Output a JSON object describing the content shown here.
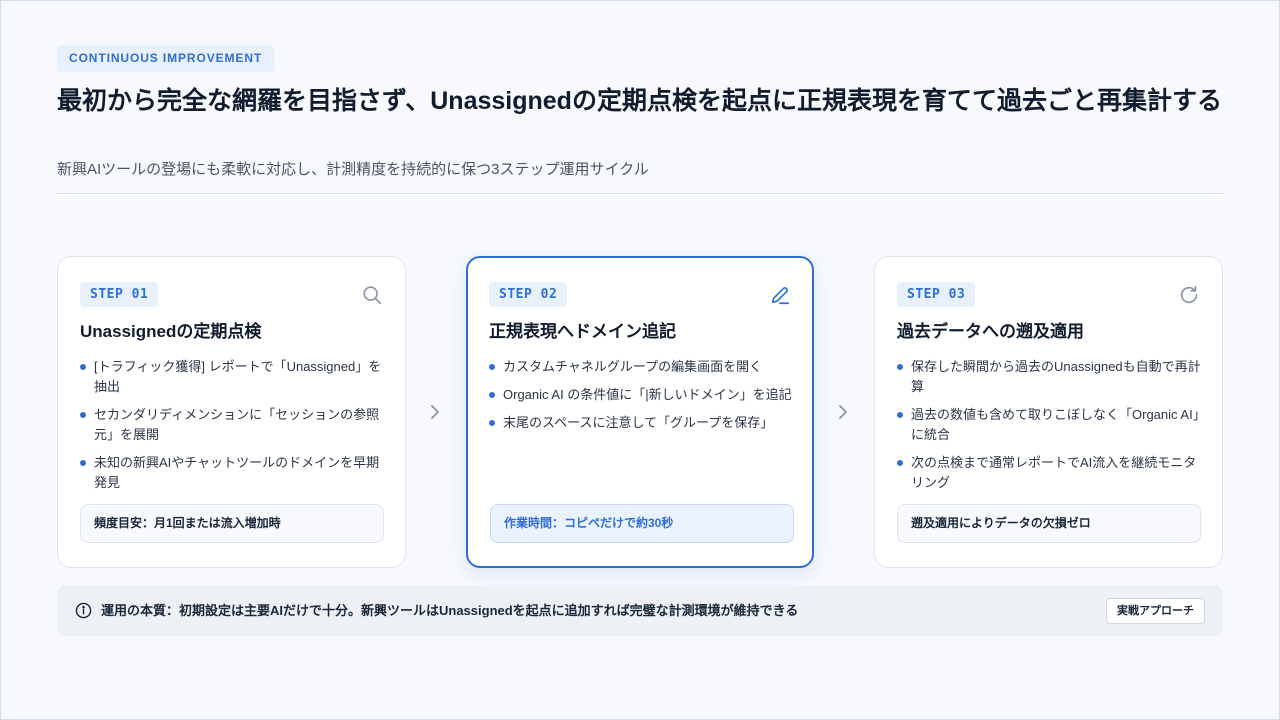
{
  "header": {
    "eyebrow": "CONTINUOUS IMPROVEMENT",
    "title": "最初から完全な網羅を目指さず、Unassignedの定期点検を起点に正規表現を育てて過去ごと再集計する",
    "subtitle": "新興AIツールの登場にも柔軟に対応し、計測精度を持続的に保つ3ステップ運用サイクル"
  },
  "steps": [
    {
      "badge": "STEP 01",
      "icon": "search-icon",
      "title": "Unassignedの定期点検",
      "bullets": [
        "[トラフィック獲得] レポートで「Unassigned」を抽出",
        "セカンダリディメンションに「セッションの参照元」を展開",
        "未知の新興AIやチャットツールのドメインを早期発見"
      ],
      "note": "頻度目安：月1回または流入増加時"
    },
    {
      "badge": "STEP 02",
      "icon": "edit-icon",
      "title": "正規表現へドメイン追記",
      "bullets": [
        "カスタムチャネルグループの編集画面を開く",
        "Organic AI の条件値に「|新しいドメイン」を追記",
        "末尾のスペースに注意して「グループを保存」"
      ],
      "note": "作業時間：コピペだけで約30秒"
    },
    {
      "badge": "STEP 03",
      "icon": "refresh-icon",
      "title": "過去データへの遡及適用",
      "bullets": [
        "保存した瞬間から過去のUnassignedも自動で再計算",
        "過去の数値も含めて取りこぼしなく「Organic AI」に統合",
        "次の点検まで通常レポートでAI流入を継続モニタリング"
      ],
      "note": "遡及適用によりデータの欠損ゼロ"
    }
  ],
  "footer": {
    "text": "運用の本質：初期設定は主要AIだけで十分。新興ツールはUnassignedを起点に追加すれば完璧な計測環境が維持できる",
    "button_label": "実戦アプローチ"
  },
  "colors": {
    "accent": "#2f6fd1",
    "background": "#f7f9fc",
    "text": "#111c2e"
  }
}
